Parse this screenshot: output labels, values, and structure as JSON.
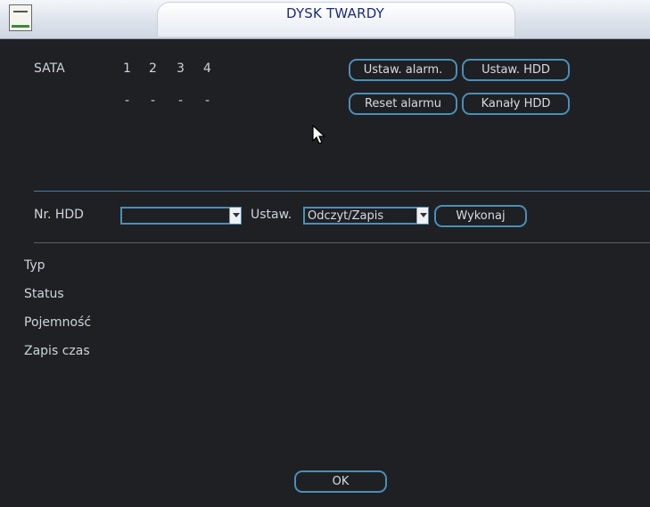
{
  "window": {
    "title": "DYSK TWARDY"
  },
  "sata": {
    "label": "SATA",
    "channels": [
      "1",
      "2",
      "3",
      "4"
    ],
    "states": [
      "-",
      "-",
      "-",
      "-"
    ]
  },
  "buttons": {
    "set_alarm": "Ustaw. alarm.",
    "set_hdd": "Ustaw. HDD",
    "reset_alarm": "Reset alarmu",
    "hdd_channels": "Kanały HDD",
    "execute": "Wykonaj",
    "ok": "OK"
  },
  "hdd_form": {
    "hdd_no_label": "Nr. HDD",
    "hdd_no_value": "",
    "set_label": "Ustaw.",
    "mode_value": "Odczyt/Zapis"
  },
  "info": {
    "type_label": "Typ",
    "status_label": "Status",
    "capacity_label": "Pojemność",
    "record_time_label": "Zapis czas"
  },
  "colors": {
    "accent": "#4a8fb8",
    "title_text": "#1d2c7a",
    "background": "#1f2023"
  }
}
